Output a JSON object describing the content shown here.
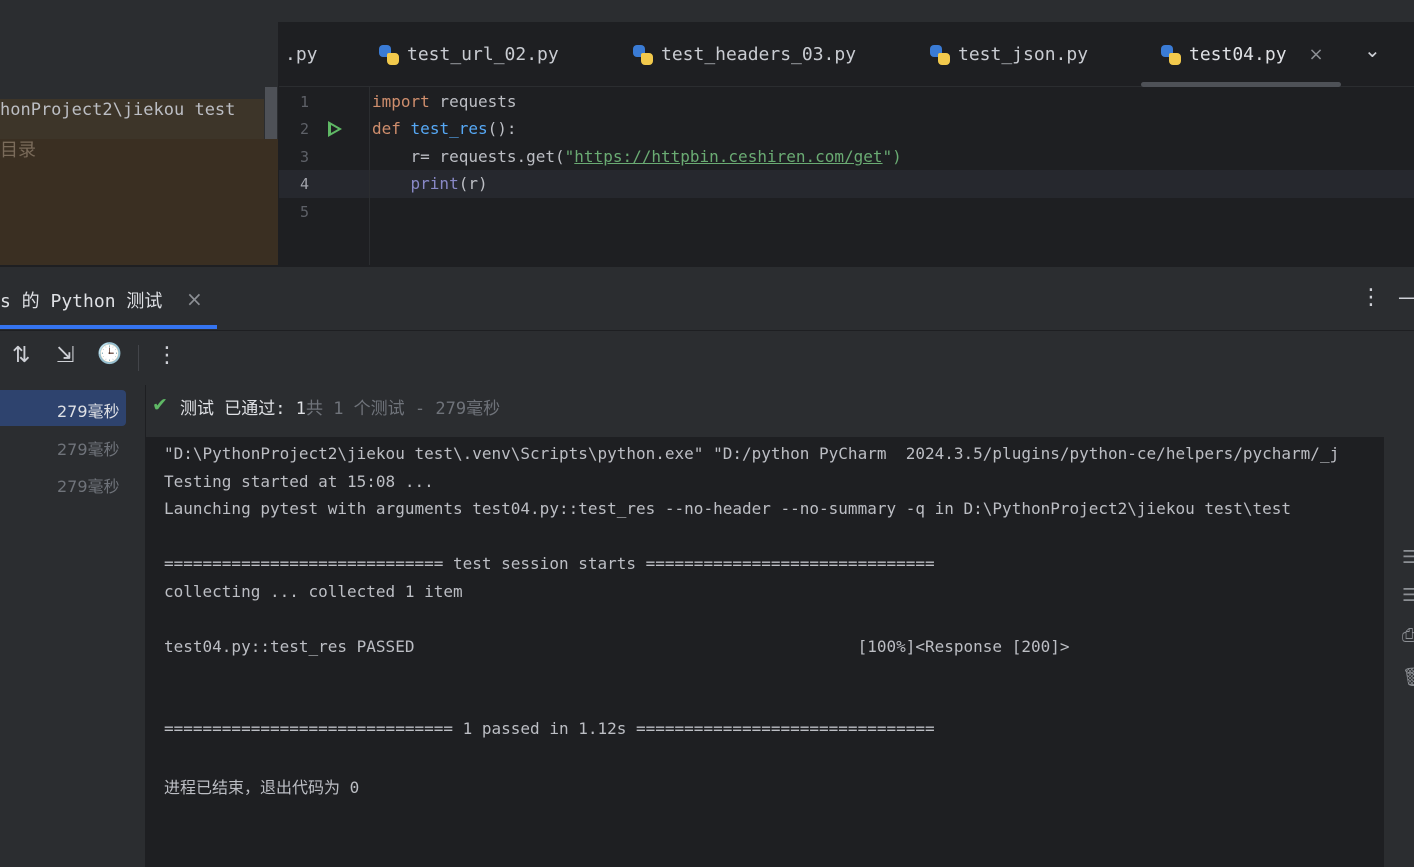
{
  "project_panel": {
    "path_text": "honProject2\\jiekou test",
    "sub_label": "目录"
  },
  "editor_tabs": [
    {
      "label": ".py"
    },
    {
      "label": "test_url_02.py"
    },
    {
      "label": "test_headers_03.py"
    },
    {
      "label": "test_json.py"
    },
    {
      "label": "test04.py",
      "active": true
    }
  ],
  "editor": {
    "line_numbers": [
      "1",
      "2",
      "3",
      "4",
      "5"
    ],
    "code": {
      "l1_kw": "import",
      "l1_rest": " requests",
      "l2_kw": "def",
      "l2_fn": "test_res",
      "l2_rest": "():",
      "l3_pre": "    r= requests.get(",
      "l3_q1": "\"",
      "l3_url": "https://httpbin.ceshiren.com/get",
      "l3_q2": "\")",
      "l4_bi": "    print",
      "l4_rest": "(r)"
    }
  },
  "run_window": {
    "tab_label": "s 的 Python 测试",
    "tab_close": "×",
    "more": "⋮",
    "minimize": "—"
  },
  "test_tree": {
    "items": [
      {
        "label": "279毫秒",
        "selected": true
      },
      {
        "label": "279毫秒",
        "selected": false
      },
      {
        "label": "279毫秒",
        "selected": false
      }
    ]
  },
  "test_status": {
    "check": "✔",
    "label": "测试 已通过: ",
    "passed": "1",
    "summary": "共 1 个测试 - 279毫秒"
  },
  "console_lines": [
    "\"D:\\PythonProject2\\jiekou test\\.venv\\Scripts\\python.exe\" \"D:/python PyCharm  2024.3.5/plugins/python-ce/helpers/pycharm/_j",
    "Testing started at 15:08 ...",
    "Launching pytest with arguments test04.py::test_res --no-header --no-summary -q in D:\\PythonProject2\\jiekou test\\test",
    "============================= test session starts ==============================",
    "collecting ... collected 1 item",
    "test04.py::test_res PASSED                                              [100%]<Response [200]>",
    "============================== 1 passed in 1.12s ===============================",
    "进程已结束，退出代码为 0"
  ],
  "icons": {
    "tab_close": "×",
    "tabs_dropdown": "⌄",
    "sort": "⇅",
    "collapse": "⇲",
    "history": "🕒",
    "toolbar_more": "⋮"
  },
  "colors": {
    "accent": "#3574f0",
    "success": "#5fb865",
    "keyword": "#cf8e6d",
    "function": "#56a8f5",
    "string": "#6aab73"
  }
}
